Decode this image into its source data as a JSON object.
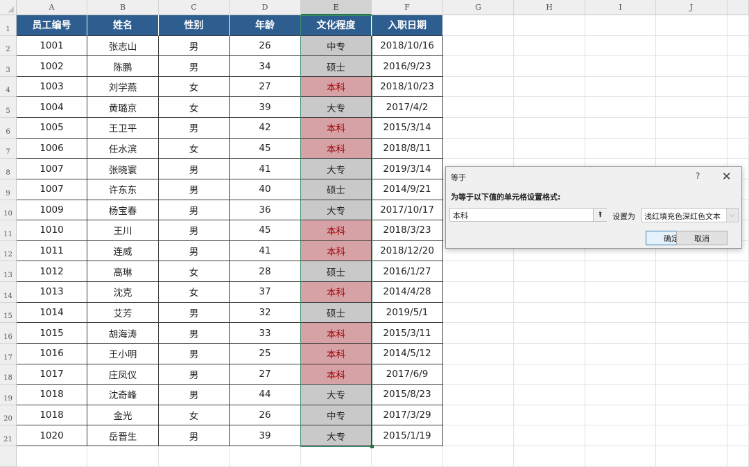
{
  "columns": [
    "A",
    "B",
    "C",
    "D",
    "E",
    "F",
    "G",
    "H",
    "I",
    "J"
  ],
  "selected_column": "E",
  "row_numbers": [
    "1",
    "2",
    "3",
    "4",
    "5",
    "6",
    "7",
    "8",
    "9",
    "10",
    "11",
    "12",
    "13",
    "14",
    "15",
    "16",
    "17",
    "18",
    "19",
    "20",
    "21"
  ],
  "table": {
    "headers": [
      "员工编号",
      "姓名",
      "性别",
      "年龄",
      "文化程度",
      "入职日期"
    ],
    "rows": [
      [
        "1001",
        "张志山",
        "男",
        "26",
        "中专",
        "2018/10/16"
      ],
      [
        "1002",
        "陈鹏",
        "男",
        "34",
        "硕士",
        "2016/9/23"
      ],
      [
        "1003",
        "刘学燕",
        "女",
        "27",
        "本科",
        "2018/10/23"
      ],
      [
        "1004",
        "黄璐京",
        "女",
        "39",
        "大专",
        "2017/4/2"
      ],
      [
        "1005",
        "王卫平",
        "男",
        "42",
        "本科",
        "2015/3/14"
      ],
      [
        "1006",
        "任水滨",
        "女",
        "45",
        "本科",
        "2018/8/11"
      ],
      [
        "1007",
        "张晓寰",
        "男",
        "41",
        "大专",
        "2019/3/14"
      ],
      [
        "1007",
        "许东东",
        "男",
        "40",
        "硕士",
        "2014/9/21"
      ],
      [
        "1009",
        "杨宝春",
        "男",
        "36",
        "大专",
        "2017/10/17"
      ],
      [
        "1010",
        "王川",
        "男",
        "45",
        "本科",
        "2018/3/23"
      ],
      [
        "1011",
        "连威",
        "男",
        "41",
        "本科",
        "2018/12/20"
      ],
      [
        "1012",
        "高琳",
        "女",
        "28",
        "硕士",
        "2016/1/27"
      ],
      [
        "1013",
        "沈克",
        "女",
        "37",
        "本科",
        "2014/4/28"
      ],
      [
        "1014",
        "艾芳",
        "男",
        "32",
        "硕士",
        "2019/5/1"
      ],
      [
        "1015",
        "胡海涛",
        "男",
        "33",
        "本科",
        "2015/3/11"
      ],
      [
        "1016",
        "王小明",
        "男",
        "25",
        "本科",
        "2014/5/12"
      ],
      [
        "1017",
        "庄凤仪",
        "男",
        "27",
        "本科",
        "2017/6/9"
      ],
      [
        "1018",
        "沈奇峰",
        "男",
        "44",
        "大专",
        "2015/8/23"
      ],
      [
        "1018",
        "金光",
        "女",
        "26",
        "中专",
        "2017/3/29"
      ],
      [
        "1020",
        "岳晋生",
        "男",
        "39",
        "大专",
        "2015/1/19"
      ]
    ]
  },
  "highlight_value": "本科",
  "colors": {
    "header_fill": "#2e5d8f",
    "highlight_fill": "#d6a2a6",
    "highlight_text": "#9c0006",
    "selection_fill": "#c9c9c9"
  },
  "dialog": {
    "title": "等于",
    "help": "?",
    "close": "✕",
    "label": "为等于以下值的单元格设置格式:",
    "value": "本科",
    "set_as_label": "设置为",
    "format_option": "浅红填充色深红色文本",
    "ok": "确定",
    "cancel": "取消"
  }
}
